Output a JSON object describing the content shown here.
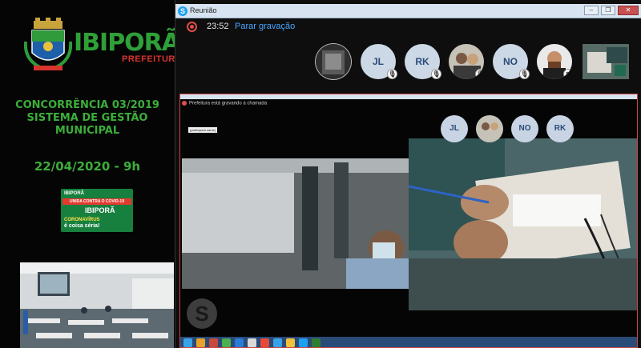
{
  "brand": {
    "name": "IBIPORÃ",
    "sub": "PREFEITURA",
    "colors": {
      "green": "#2fa037",
      "red": "#d8342e"
    }
  },
  "event": {
    "title_lines": [
      "CONCORRÊNCIA 03/2019",
      "SISTEMA DE GESTÃO",
      "MUNICIPAL"
    ],
    "date": "22/04/2020 - 9h"
  },
  "campaign": {
    "header": "IBIPORÃ",
    "banner": "UNIDA CONTRA O COVID-19",
    "logo": "IBIPORÃ",
    "line1": "CORONAVÍRUS",
    "line2": "é coisa séria!"
  },
  "window": {
    "title": "Reunião",
    "buttons": [
      "minimize",
      "maximize",
      "close"
    ]
  },
  "recording": {
    "time": "23:52",
    "stop_label": "Parar gravação"
  },
  "participants": [
    {
      "kind": "photo"
    },
    {
      "initials": "JL",
      "muted": true
    },
    {
      "initials": "RK",
      "muted": true
    },
    {
      "kind": "photo",
      "muted": true
    },
    {
      "initials": "NO",
      "muted": true
    },
    {
      "kind": "photo"
    },
    {
      "kind": "video-thumb"
    }
  ],
  "shared_screen": {
    "recording_notice": "Prefeitura está gravando a chamada",
    "tooltip": "(participant name)",
    "participants": [
      {
        "initials": "JL"
      },
      {
        "kind": "photo"
      },
      {
        "initials": "NO"
      },
      {
        "initials": "RK"
      }
    ]
  }
}
